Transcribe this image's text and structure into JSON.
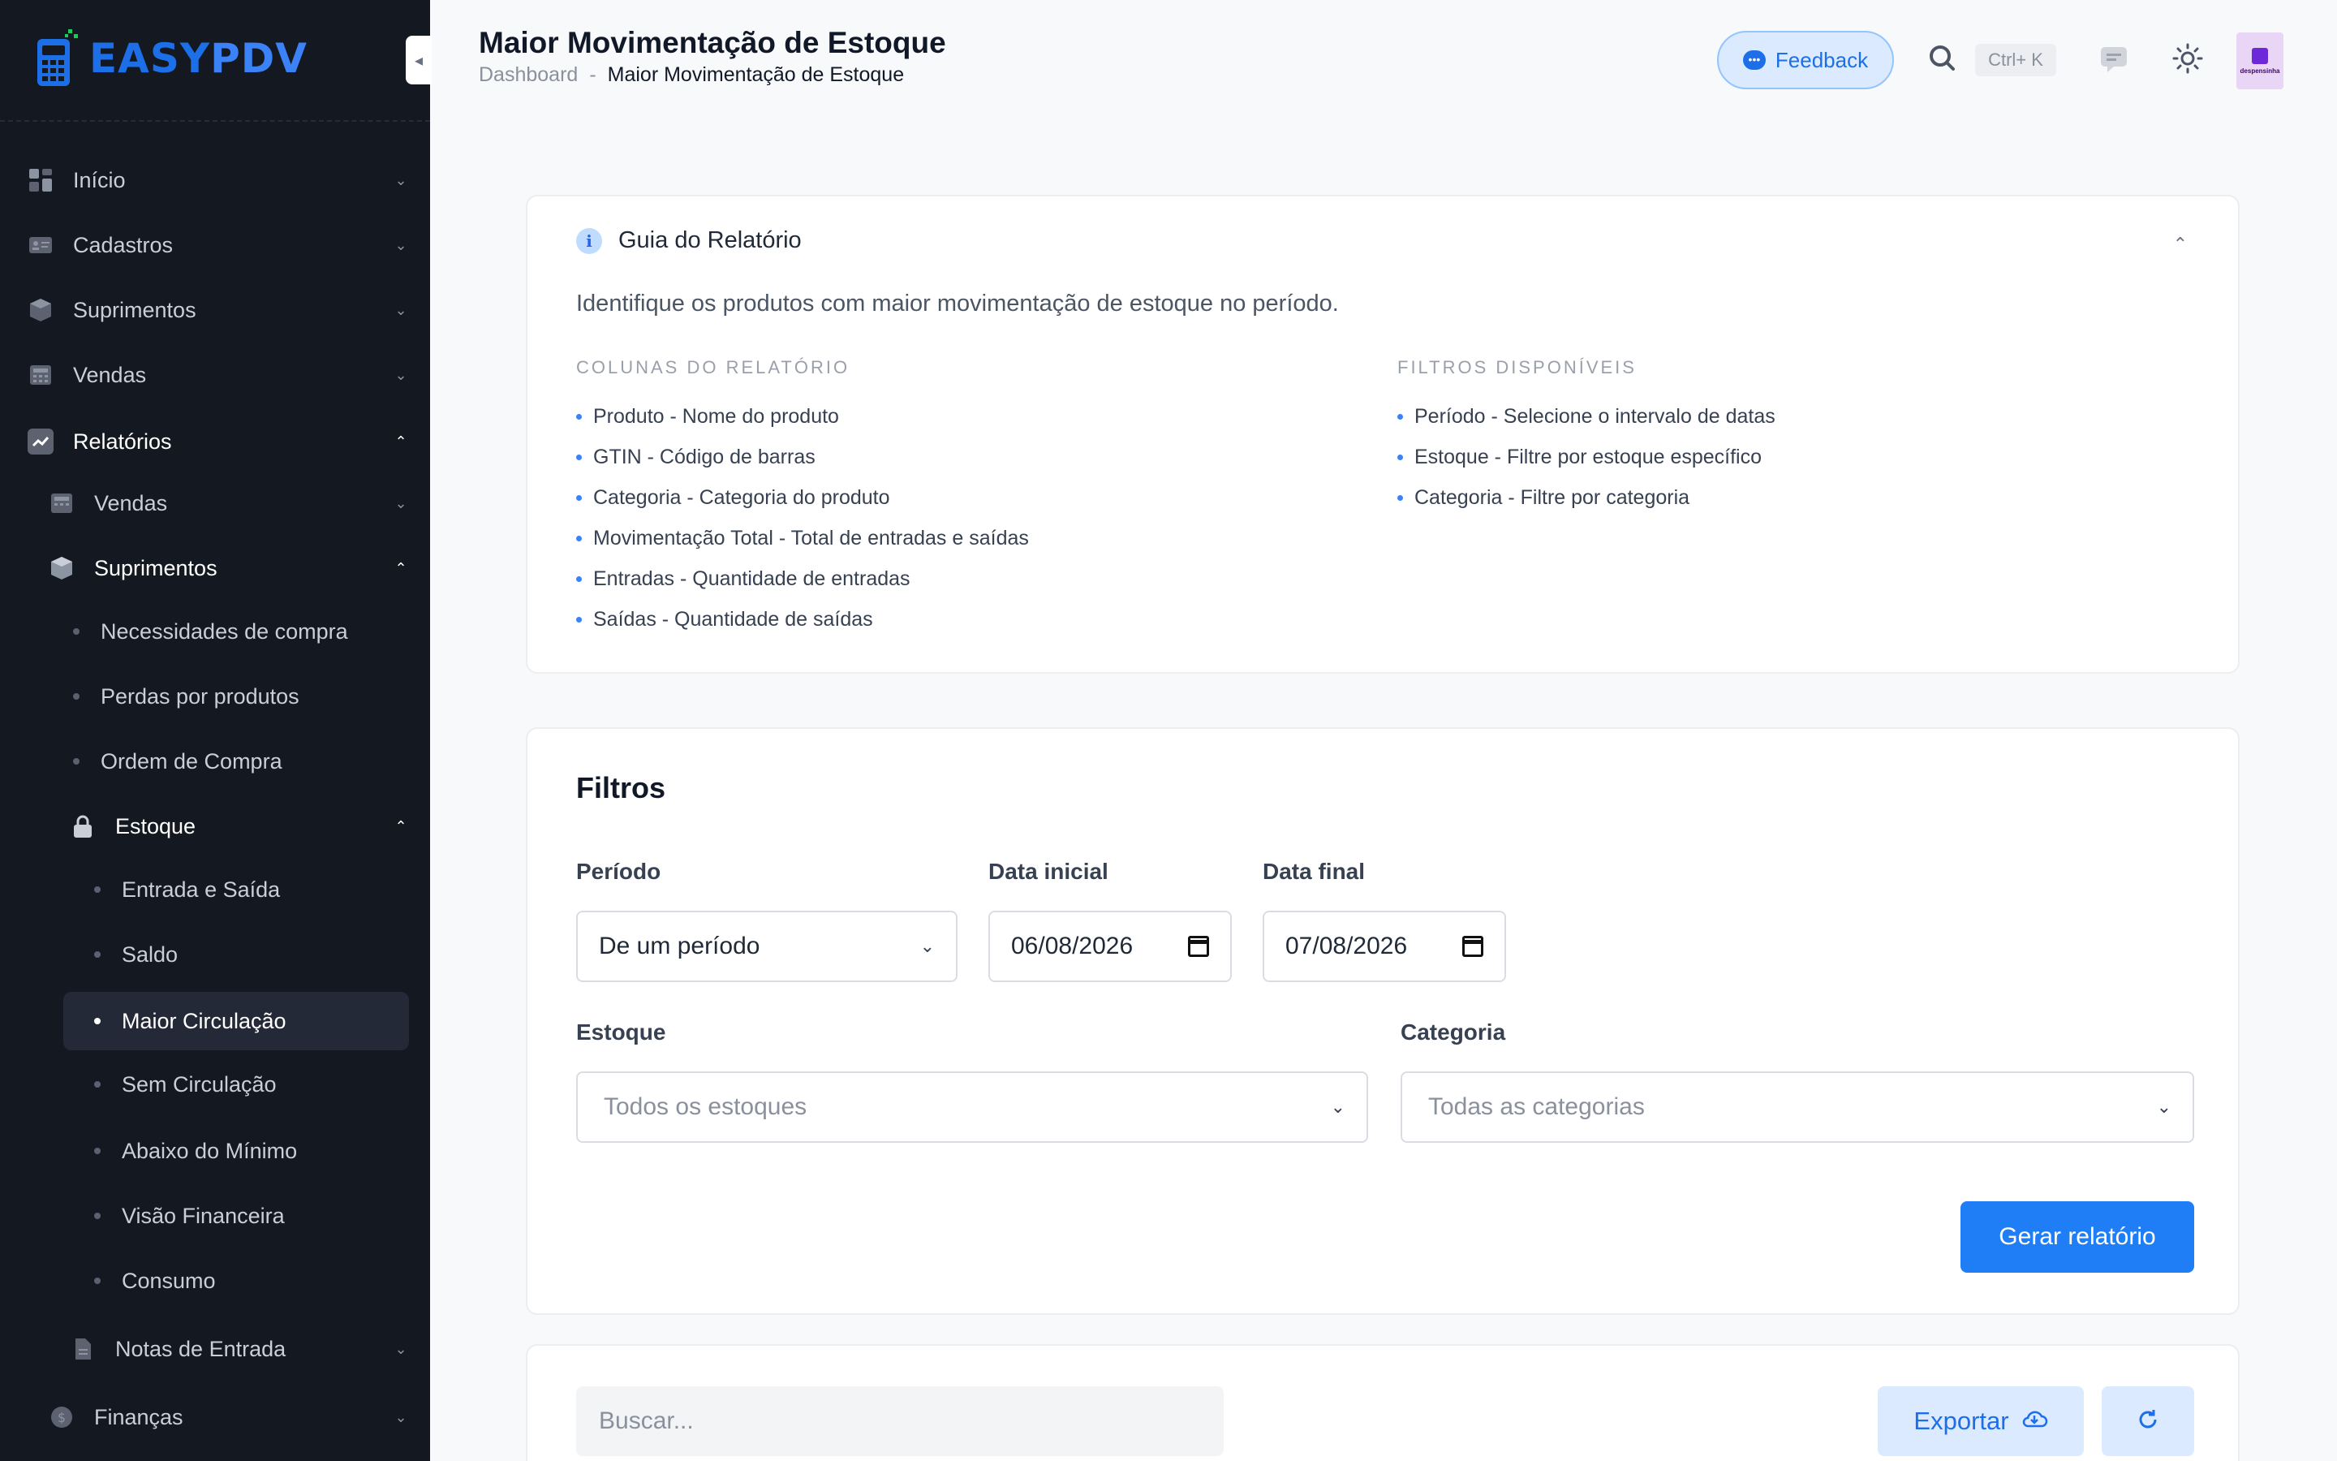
{
  "brand": {
    "name_part1": "EASY",
    "name_part2": "PDV"
  },
  "sidebar": {
    "items": [
      {
        "label": "Início",
        "icon": "dashboard-icon"
      },
      {
        "label": "Cadastros",
        "icon": "id-card-icon"
      },
      {
        "label": "Suprimentos",
        "icon": "box-icon"
      },
      {
        "label": "Vendas",
        "icon": "register-icon"
      },
      {
        "label": "Relatórios",
        "icon": "chart-line-icon"
      }
    ],
    "relatorios_children": {
      "vendas": "Vendas",
      "suprimentos": "Suprimentos",
      "suprimentos_children": [
        "Necessidades de compra",
        "Perdas por produtos",
        "Ordem de Compra"
      ],
      "estoque": "Estoque",
      "estoque_children": [
        "Entrada e Saída",
        "Saldo",
        "Maior Circulação",
        "Sem Circulação",
        "Abaixo do Mínimo",
        "Visão Financeira",
        "Consumo"
      ],
      "notas": "Notas de Entrada",
      "financas": "Finanças"
    },
    "active_item": "Maior Circulação"
  },
  "header": {
    "title": "Maior Movimentação de Estoque",
    "breadcrumb": {
      "root": "Dashboard",
      "separator": "-",
      "current": "Maior Movimentação de Estoque"
    },
    "feedback_label": "Feedback",
    "shortcut": "Ctrl+ K",
    "avatar_text": "despensinha"
  },
  "guide": {
    "title": "Guia do Relatório",
    "description": "Identifique os produtos com maior movimentação de estoque no período.",
    "columns_title": "COLUNAS DO RELATÓRIO",
    "columns": [
      "Produto - Nome do produto",
      "GTIN - Código de barras",
      "Categoria - Categoria do produto",
      "Movimentação Total - Total de entradas e saídas",
      "Entradas - Quantidade de entradas",
      "Saídas - Quantidade de saídas"
    ],
    "filters_title": "FILTROS DISPONÍVEIS",
    "filters": [
      "Período - Selecione o intervalo de datas",
      "Estoque - Filtre por estoque específico",
      "Categoria - Filtre por categoria"
    ]
  },
  "filters": {
    "title": "Filtros",
    "periodo_label": "Período",
    "periodo_value": "De um período",
    "data_inicial_label": "Data inicial",
    "data_inicial_value": "06/08/2026",
    "data_final_label": "Data final",
    "data_final_value": "07/08/2026",
    "estoque_label": "Estoque",
    "estoque_placeholder": "Todos os estoques",
    "categoria_label": "Categoria",
    "categoria_placeholder": "Todas as categorias",
    "generate_label": "Gerar relatório"
  },
  "results": {
    "search_placeholder": "Buscar...",
    "export_label": "Exportar"
  },
  "colors": {
    "sidebar_bg": "#141820",
    "accent": "#1f7ef6",
    "page_bg": "#f8f9fb"
  }
}
